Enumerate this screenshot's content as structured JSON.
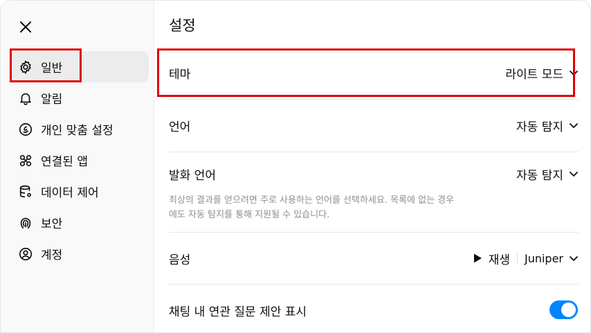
{
  "sidebar": {
    "items": [
      {
        "label": "일반",
        "icon": "gear-icon"
      },
      {
        "label": "알림",
        "icon": "bell-icon"
      },
      {
        "label": "개인 맞춤 설정",
        "icon": "personalize-icon"
      },
      {
        "label": "연결된 앱",
        "icon": "apps-icon"
      },
      {
        "label": "데이터 제어",
        "icon": "database-icon"
      },
      {
        "label": "보안",
        "icon": "security-icon"
      },
      {
        "label": "계정",
        "icon": "account-icon"
      }
    ]
  },
  "main": {
    "title": "설정",
    "theme": {
      "label": "테마",
      "value": "라이트 모드"
    },
    "language": {
      "label": "언어",
      "value": "자동 탐지"
    },
    "spoken_language": {
      "label": "발화 언어",
      "value": "자동 탐지",
      "description_line1": "최상의 결과를 얻으려면 주로 사용하는 언어를 선택하세요. 목록에 없는 경우",
      "description_line2": "에도 자동 탐지를 통해 지원될 수 있습니다."
    },
    "voice": {
      "label": "음성",
      "play_label": "재생",
      "value": "Juniper"
    },
    "suggestions": {
      "label": "채팅 내 연관 질문 제안 표시",
      "enabled": true
    }
  },
  "colors": {
    "highlight": "#e00000",
    "toggle_on": "#0285ff"
  }
}
